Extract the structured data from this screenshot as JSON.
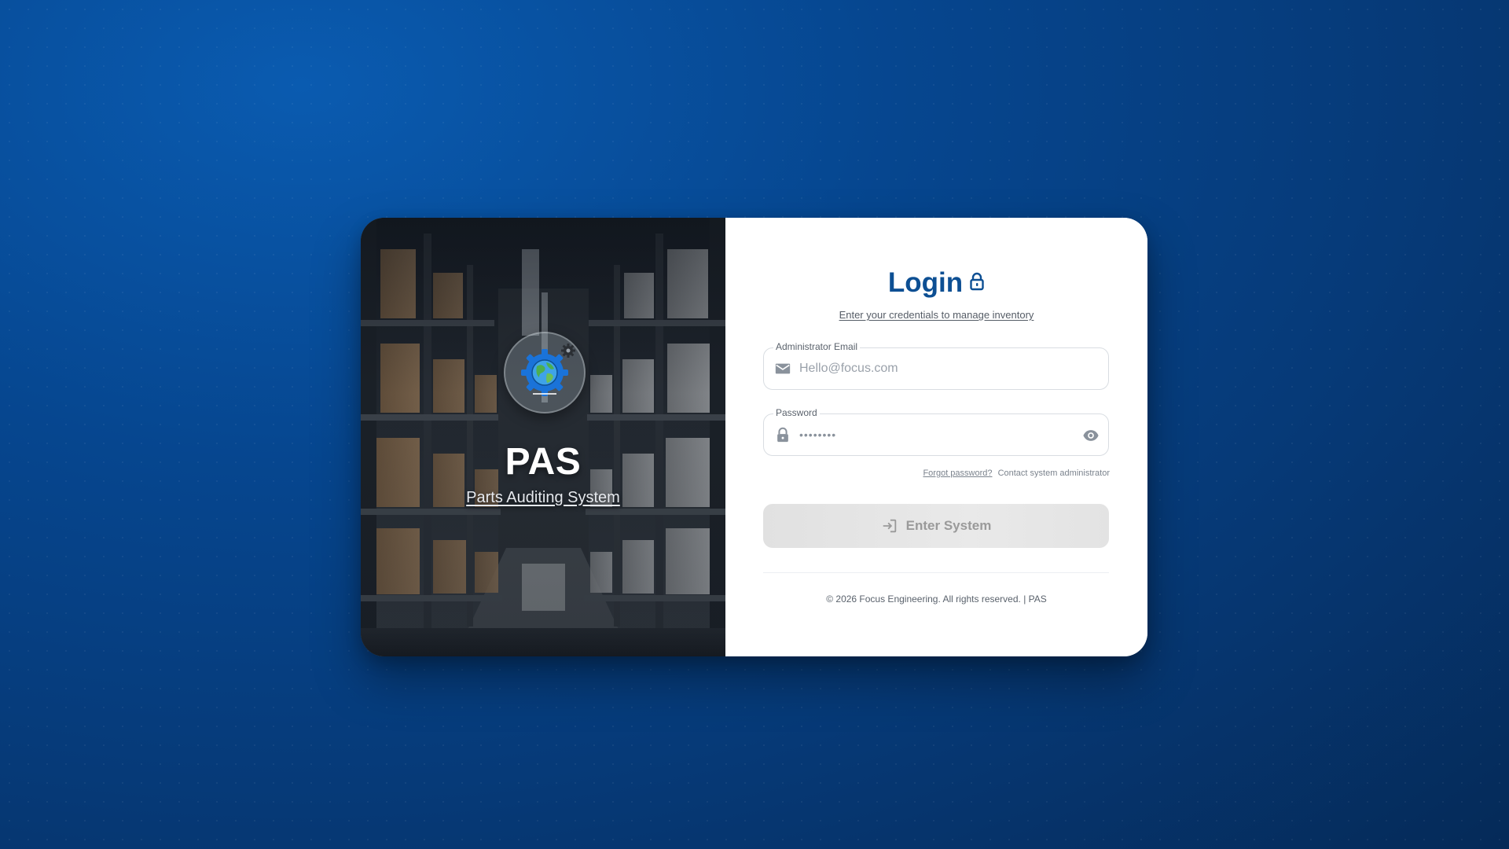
{
  "hero": {
    "title": "PAS",
    "subtitle": "Parts Auditing System"
  },
  "login": {
    "title": "Login",
    "subtitle": "Enter your credentials to manage inventory"
  },
  "email_field": {
    "label": "Administrator Email",
    "placeholder": "Hello@focus.com",
    "icon": "mail-icon"
  },
  "password_field": {
    "label": "Password",
    "value": "••••••••",
    "icon": "lock-icon",
    "toggle_icon": "eye-icon"
  },
  "help": {
    "forgot": "Forgot password?",
    "contact": "Contact system administrator"
  },
  "submit": {
    "label": "Enter System",
    "icon": "login-arrow-icon"
  },
  "footer": {
    "text": "© 2026 Focus Engineering. All rights reserved. | PAS"
  },
  "colors": {
    "background": "#06468f",
    "accent": "#0d4f93",
    "button_disabled": "#e3e3e3"
  }
}
